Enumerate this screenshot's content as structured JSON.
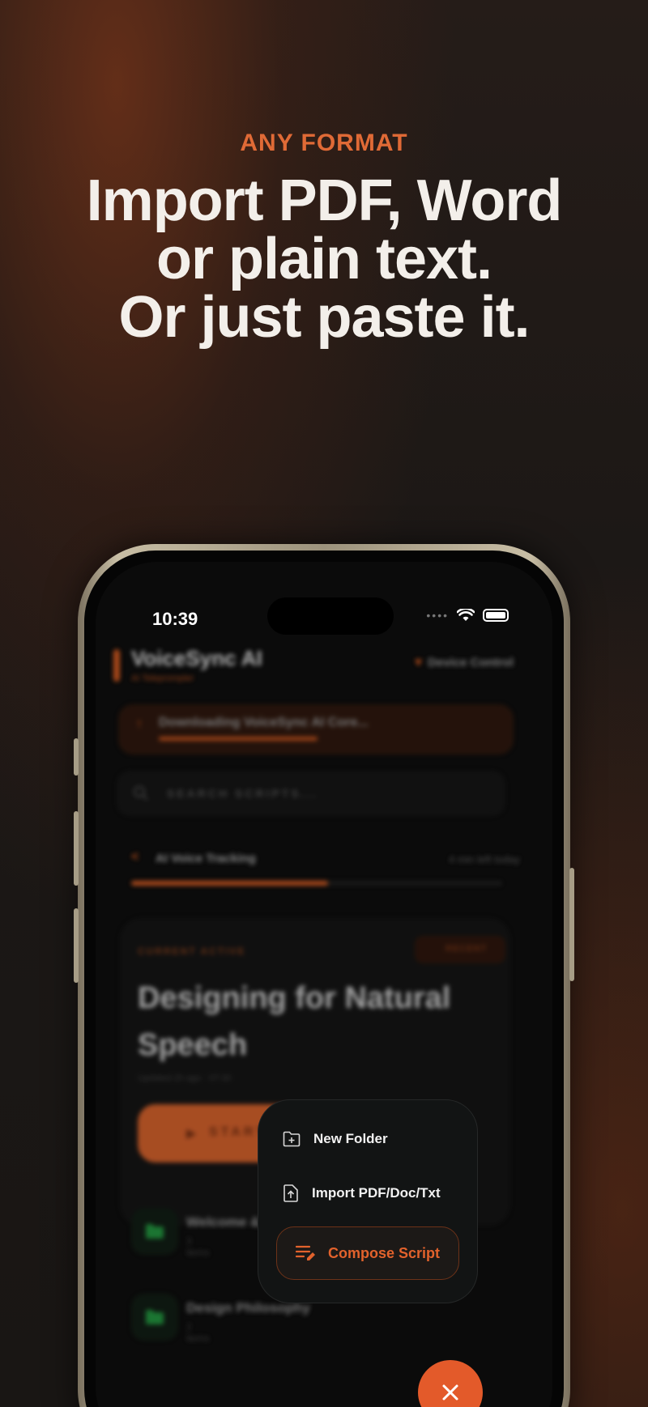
{
  "promo": {
    "kicker": "ANY FORMAT",
    "headline_lines": [
      "Import PDF, Word",
      "or plain text.",
      "Or just paste it."
    ]
  },
  "status_bar": {
    "time": "10:39"
  },
  "app": {
    "title": "VoiceSync AI",
    "subtitle": "AI Teleprompter",
    "device_control_label": "Device Control",
    "download_text": "Downloading VoiceSync AI Core...",
    "download_progress": 0.45,
    "search_placeholder": "SEARCH SCRIPTS...",
    "tracking_label": "AI Voice Tracking",
    "tracking_right": "4 min left today",
    "tracking_progress": 0.53,
    "current_card": {
      "label": "CURRENT ACTIVE",
      "badge": "RECENT",
      "title": "Designing for Natural Speech",
      "meta": "Updated 2h ago · 07:30",
      "start_label": "START"
    },
    "folders": [
      {
        "name": "Welcome & Introduction",
        "count": "3 items"
      },
      {
        "name": "Design Philosophy",
        "count": "2 items"
      }
    ]
  },
  "menu": {
    "items": [
      {
        "label": "New Folder",
        "icon": "folder-plus-icon"
      },
      {
        "label": "Import PDF/Doc/Txt",
        "icon": "file-upload-icon"
      }
    ],
    "compose_label": "Compose Script",
    "compose_icon": "compose-edit-icon",
    "close_icon": "close-icon"
  },
  "colors": {
    "accent": "#e35a2a",
    "background": "#1b1715",
    "text": "#f3efea"
  }
}
